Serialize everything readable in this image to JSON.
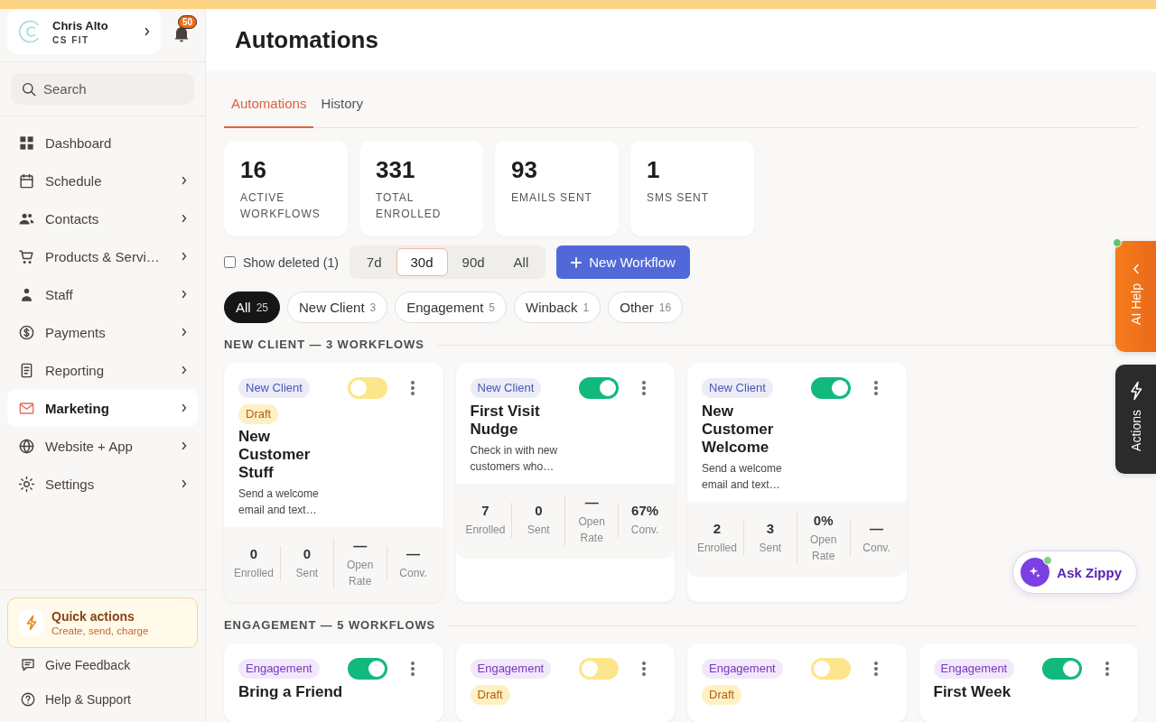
{
  "sidebar": {
    "account": {
      "name": "Chris Alto",
      "business": "CS FIT"
    },
    "notifications": {
      "count": "50"
    },
    "search": {
      "placeholder": "Search"
    },
    "nav": [
      {
        "label": "Dashboard",
        "selected": false,
        "submenu": false
      },
      {
        "label": "Schedule",
        "selected": false,
        "submenu": true
      },
      {
        "label": "Contacts",
        "selected": false,
        "submenu": true
      },
      {
        "label": "Products & Servi…",
        "selected": false,
        "submenu": true
      },
      {
        "label": "Staff",
        "selected": false,
        "submenu": true
      },
      {
        "label": "Payments",
        "selected": false,
        "submenu": true
      },
      {
        "label": "Reporting",
        "selected": false,
        "submenu": true
      },
      {
        "label": "Marketing",
        "selected": true,
        "submenu": true
      },
      {
        "label": "Website + App",
        "selected": false,
        "submenu": true
      },
      {
        "label": "Settings",
        "selected": false,
        "submenu": true
      }
    ],
    "quick_actions": {
      "title": "Quick actions",
      "subtitle": "Create, send, charge"
    },
    "links": [
      {
        "label": "Give Feedback"
      },
      {
        "label": "Help & Support"
      }
    ]
  },
  "header": {
    "title": "Automations"
  },
  "tabs": [
    {
      "label": "Automations",
      "selected": true
    },
    {
      "label": "History",
      "selected": false
    }
  ],
  "stats": [
    {
      "value": "16",
      "label": "ACTIVE WORKFLOWS"
    },
    {
      "value": "331",
      "label": "TOTAL ENROLLED"
    },
    {
      "value": "93",
      "label": "EMAILS SENT"
    },
    {
      "value": "1",
      "label": "SMS SENT"
    }
  ],
  "controls": {
    "show_deleted": {
      "label": "Show deleted (1)",
      "checked": false
    },
    "ranges": [
      {
        "label": "7d",
        "selected": false
      },
      {
        "label": "30d",
        "selected": true
      },
      {
        "label": "90d",
        "selected": false
      },
      {
        "label": "All",
        "selected": false
      }
    ],
    "new_workflow": {
      "label": "New Workflow"
    }
  },
  "filters": [
    {
      "label": "All",
      "count": "25",
      "selected": true
    },
    {
      "label": "New Client",
      "count": "3",
      "selected": false
    },
    {
      "label": "Engagement",
      "count": "5",
      "selected": false
    },
    {
      "label": "Winback",
      "count": "1",
      "selected": false
    },
    {
      "label": "Other",
      "count": "16",
      "selected": false
    }
  ],
  "sections": [
    {
      "heading": "NEW CLIENT — 3 WORKFLOWS",
      "workflows": [
        {
          "tag": "New Client",
          "color": "#4856b8",
          "on": false,
          "badge": "Draft",
          "title": "New Customer Stuff",
          "description": "Send a welcome email and text…",
          "stats": [
            {
              "value": "0",
              "label": "Enrolled"
            },
            {
              "value": "0",
              "label": "Sent"
            },
            {
              "value": "—",
              "label": "Open Rate"
            },
            {
              "value": "—",
              "label": "Conv."
            }
          ]
        },
        {
          "tag": "New Client",
          "color": "#4856b8",
          "on": true,
          "title": "First Visit Nudge",
          "description": "Check in with new customers who…",
          "stats": [
            {
              "value": "7",
              "label": "Enrolled"
            },
            {
              "value": "0",
              "label": "Sent"
            },
            {
              "value": "—",
              "label": "Open Rate"
            },
            {
              "value": "67%",
              "label": "Conv."
            }
          ]
        },
        {
          "tag": "New Client",
          "color": "#4856b8",
          "on": true,
          "title": "New Customer Welcome",
          "description": "Send a welcome email and text…",
          "stats": [
            {
              "value": "2",
              "label": "Enrolled"
            },
            {
              "value": "3",
              "label": "Sent"
            },
            {
              "value": "0%",
              "label": "Open Rate"
            },
            {
              "value": "—",
              "label": "Conv."
            }
          ]
        }
      ]
    },
    {
      "heading": "ENGAGEMENT — 5 WORKFLOWS",
      "workflows": [
        {
          "tag": "Engagement",
          "color": "#7b35c6",
          "on": true,
          "title": "Bring a Friend"
        },
        {
          "tag": "Engagement",
          "color": "#7b35c6",
          "on": false,
          "badge": "Draft"
        },
        {
          "tag": "Engagement",
          "color": "#7b35c6",
          "on": false,
          "badge": "Draft"
        },
        {
          "tag": "Engagement",
          "color": "#7b35c6",
          "on": true,
          "title": "First Week"
        }
      ]
    }
  ],
  "side_tabs": [
    {
      "label": "AI Help",
      "kind": "ai",
      "online": true
    },
    {
      "label": "Actions",
      "kind": "actions",
      "online": false
    }
  ],
  "assistant": {
    "label": "Ask Zippy",
    "online": true
  }
}
